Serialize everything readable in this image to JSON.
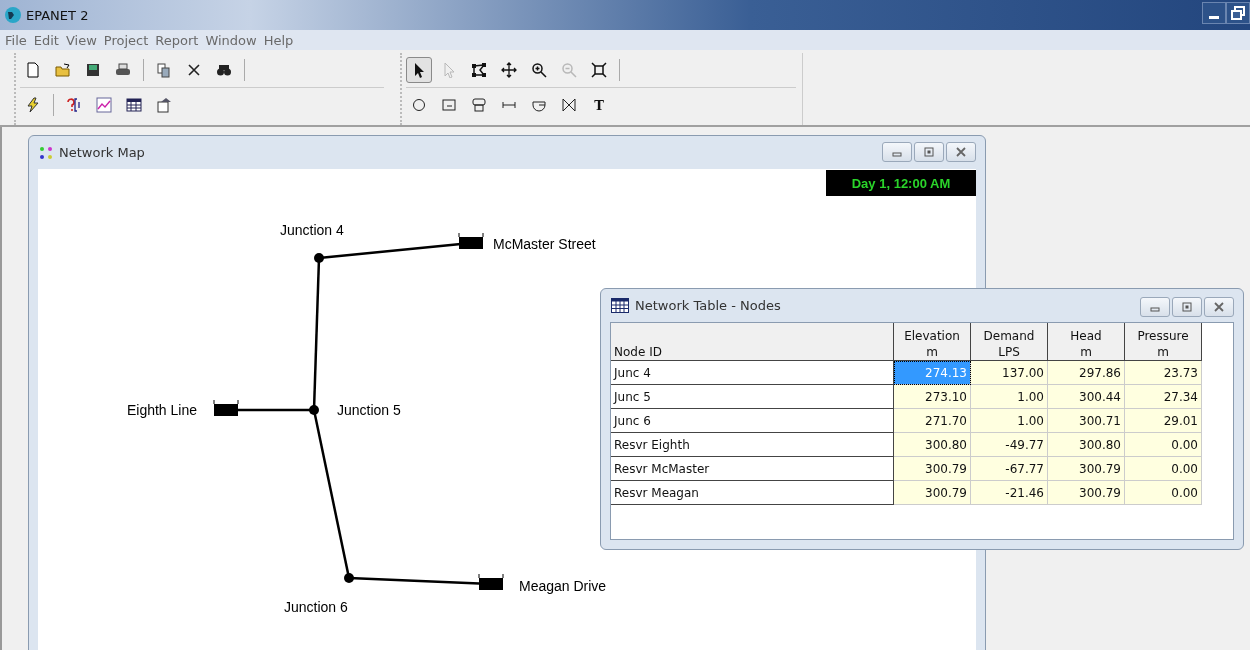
{
  "window": {
    "title": "EPANET 2"
  },
  "menu": [
    "File",
    "Edit",
    "View",
    "Project",
    "Report",
    "Window",
    "Help"
  ],
  "toolbars": {
    "standard": [
      {
        "kind": "new"
      },
      {
        "kind": "open"
      },
      {
        "kind": "save"
      },
      {
        "kind": "print"
      },
      {
        "kind": "sep"
      },
      {
        "kind": "copy"
      },
      {
        "kind": "delete"
      },
      {
        "kind": "find"
      },
      {
        "kind": "sep"
      }
    ],
    "project": [
      {
        "kind": "run"
      },
      {
        "kind": "sep"
      },
      {
        "kind": "query"
      },
      {
        "kind": "graph"
      },
      {
        "kind": "table"
      },
      {
        "kind": "options"
      }
    ],
    "map": [
      {
        "kind": "select",
        "selected": true,
        "disabled": false
      },
      {
        "kind": "vertex",
        "selected": false,
        "disabled": true
      },
      {
        "kind": "region",
        "selected": false,
        "disabled": false
      },
      {
        "kind": "pan",
        "selected": false,
        "disabled": false
      },
      {
        "kind": "zoom-in",
        "selected": false,
        "disabled": false
      },
      {
        "kind": "zoom-out",
        "selected": false,
        "disabled": true
      },
      {
        "kind": "extent",
        "selected": false,
        "disabled": false
      }
    ],
    "objects": [
      {
        "kind": "junction"
      },
      {
        "kind": "reservoir"
      },
      {
        "kind": "tank"
      },
      {
        "kind": "pipe"
      },
      {
        "kind": "pump"
      },
      {
        "kind": "valve"
      },
      {
        "kind": "label",
        "text": "T"
      }
    ]
  },
  "network_map": {
    "title": "Network Map",
    "clock": "Day 1, 12:00 AM",
    "nodes": [
      {
        "kind": "junction",
        "label": "Junction 4"
      },
      {
        "kind": "junction",
        "label": "Junction 5"
      },
      {
        "kind": "junction",
        "label": "Junction 6"
      },
      {
        "kind": "reservoir",
        "label": "McMaster Street"
      },
      {
        "kind": "reservoir",
        "label": "Eighth Line"
      },
      {
        "kind": "reservoir",
        "label": "Meagan Drive"
      }
    ]
  },
  "node_table": {
    "title": "Network Table - Nodes",
    "id_header": "Node ID",
    "columns": [
      {
        "title": "Elevation",
        "unit": "m"
      },
      {
        "title": "Demand",
        "unit": "LPS"
      },
      {
        "title": "Head",
        "unit": "m"
      },
      {
        "title": "Pressure",
        "unit": "m"
      }
    ],
    "rows": [
      {
        "id": "Junc 4",
        "cells": [
          {
            "value": "274.13",
            "selected": true
          },
          {
            "value": "137.00",
            "selected": false
          },
          {
            "value": "297.86",
            "selected": false
          },
          {
            "value": "23.73",
            "selected": false
          }
        ]
      },
      {
        "id": "Junc 5",
        "cells": [
          {
            "value": "273.10",
            "selected": false
          },
          {
            "value": "1.00",
            "selected": false
          },
          {
            "value": "300.44",
            "selected": false
          },
          {
            "value": "27.34",
            "selected": false
          }
        ]
      },
      {
        "id": "Junc 6",
        "cells": [
          {
            "value": "271.70",
            "selected": false
          },
          {
            "value": "1.00",
            "selected": false
          },
          {
            "value": "300.71",
            "selected": false
          },
          {
            "value": "29.01",
            "selected": false
          }
        ]
      },
      {
        "id": "Resvr Eighth",
        "cells": [
          {
            "value": "300.80",
            "selected": false
          },
          {
            "value": "-49.77",
            "selected": false
          },
          {
            "value": "300.80",
            "selected": false
          },
          {
            "value": "0.00",
            "selected": false
          }
        ]
      },
      {
        "id": "Resvr McMaster",
        "cells": [
          {
            "value": "300.79",
            "selected": false
          },
          {
            "value": "-67.77",
            "selected": false
          },
          {
            "value": "300.79",
            "selected": false
          },
          {
            "value": "0.00",
            "selected": false
          }
        ]
      },
      {
        "id": "Resvr Meagan",
        "cells": [
          {
            "value": "300.79",
            "selected": false
          },
          {
            "value": "-21.46",
            "selected": false
          },
          {
            "value": "300.79",
            "selected": false
          },
          {
            "value": "0.00",
            "selected": false
          }
        ]
      }
    ]
  }
}
